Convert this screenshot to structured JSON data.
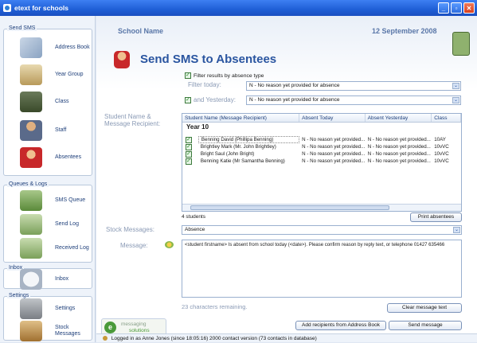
{
  "window": {
    "title": "etext for schools",
    "buttons": [
      "_",
      "▫",
      "✕"
    ]
  },
  "sidebar": {
    "groups": [
      {
        "label": "Send SMS",
        "items": [
          {
            "label": "Address Book",
            "icon": "address-book-icon"
          },
          {
            "label": "Year Group",
            "icon": "year-group-icon"
          },
          {
            "label": "Class",
            "icon": "class-icon"
          },
          {
            "label": "Staff",
            "icon": "staff-icon"
          },
          {
            "label": "Absentees",
            "icon": "absentees-icon"
          }
        ]
      },
      {
        "label": "Queues & Logs",
        "items": [
          {
            "label": "SMS Queue",
            "icon": "sms-queue-icon"
          },
          {
            "label": "Send Log",
            "icon": "send-log-icon"
          },
          {
            "label": "Received Log",
            "icon": "received-log-icon"
          }
        ]
      },
      {
        "label": "Inbox",
        "items": [
          {
            "label": "Inbox",
            "icon": "inbox-icon"
          }
        ]
      },
      {
        "label": "Settings",
        "items": [
          {
            "label": "Settings",
            "icon": "settings-icon"
          },
          {
            "label": "Stock Messages",
            "icon": "stock-messages-icon"
          }
        ]
      }
    ]
  },
  "header": {
    "school_name": "School Name",
    "date": "12 September 2008",
    "page_title": "Send SMS to Absentees"
  },
  "filters": {
    "filter_by_absence_label": "Filter results by absence type",
    "filter_today_label": "Filter today:",
    "filter_today_value": "N - No reason yet provided for absence",
    "and_yesterday_label": "and Yesterday:",
    "and_yesterday_value": "N - No reason yet provided for absence"
  },
  "recipients": {
    "label": "Student Name & Message Recipient:",
    "columns": [
      "Student Name (Message Recipient)",
      "Absent Today",
      "Absent Yesterday",
      "Class"
    ],
    "group": "Year 10",
    "rows": [
      {
        "name": "Benning David (Phillipa Benning)",
        "today": "N - No reason yet provided...",
        "yesterday": "N - No reason yet provided...",
        "class": "10AY"
      },
      {
        "name": "Brightley Mark (Mr. John Brightley)",
        "today": "N - No reason yet provided...",
        "yesterday": "N - No reason yet provided...",
        "class": "10vVC"
      },
      {
        "name": "Bright Saul (John Bright)",
        "today": "N - No reason yet provided...",
        "yesterday": "N - No reason yet provided...",
        "class": "10vVC"
      },
      {
        "name": "Benning Katie (Mr Samantha Benning)",
        "today": "N - No reason yet provided...",
        "yesterday": "N - No reason yet provided...",
        "class": "10vVC"
      }
    ],
    "count": "4 students",
    "print_button": "Print absentees"
  },
  "stock": {
    "label": "Stock Messages:",
    "value": "Absence"
  },
  "message": {
    "label": "Message:",
    "text": "<student firstname> Is absent from school today (<date>). Please confirm reason by reply text, or telephone 01427 635466",
    "remaining": "23 characters remaining.",
    "clear_button": "Clear message text"
  },
  "footer": {
    "brand_top": "messaging",
    "brand_bottom": "solutions",
    "add_button": "Add recipients from Address Book",
    "send_button": "Send message"
  },
  "status": {
    "text": "Logged in as Anne Jones (since 18:05:16)        2000 contact version  (73 contacts in database)"
  }
}
